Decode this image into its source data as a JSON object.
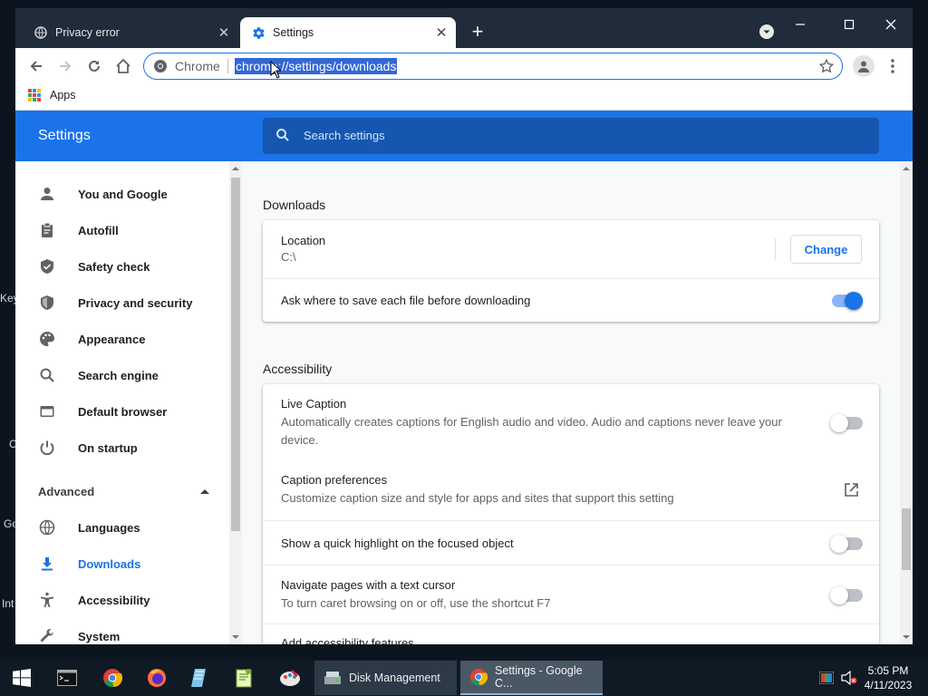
{
  "desktop": {
    "labels": [
      "Key",
      "C",
      "Go",
      "Int"
    ]
  },
  "tabs": [
    {
      "title": "Privacy error",
      "icon": "globe-icon"
    },
    {
      "title": "Settings",
      "icon": "settings-gear-icon"
    }
  ],
  "omnibox": {
    "chip": "Chrome",
    "url": "chrome://settings/downloads"
  },
  "bookmarks": {
    "apps_label": "Apps"
  },
  "settings": {
    "title": "Settings",
    "search_placeholder": "Search settings"
  },
  "sidebar": {
    "items": [
      {
        "label": "You and Google",
        "icon": "person-icon"
      },
      {
        "label": "Autofill",
        "icon": "clipboard-icon"
      },
      {
        "label": "Safety check",
        "icon": "shield-check-icon"
      },
      {
        "label": "Privacy and security",
        "icon": "shield-icon"
      },
      {
        "label": "Appearance",
        "icon": "palette-icon"
      },
      {
        "label": "Search engine",
        "icon": "search-icon"
      },
      {
        "label": "Default browser",
        "icon": "browser-icon"
      },
      {
        "label": "On startup",
        "icon": "power-icon"
      }
    ],
    "advanced_label": "Advanced",
    "advanced_items": [
      {
        "label": "Languages",
        "icon": "globe-icon"
      },
      {
        "label": "Downloads",
        "icon": "download-icon",
        "selected": true
      },
      {
        "label": "Accessibility",
        "icon": "accessibility-icon"
      },
      {
        "label": "System",
        "icon": "wrench-icon"
      }
    ]
  },
  "downloads": {
    "section_title": "Downloads",
    "location_label": "Location",
    "location_value": "C:\\",
    "change_label": "Change",
    "ask_label": "Ask where to save each file before downloading",
    "ask_enabled": true
  },
  "accessibility": {
    "section_title": "Accessibility",
    "live_caption_label": "Live Caption",
    "live_caption_sub": "Automatically creates captions for English audio and video. Audio and captions never leave your device.",
    "live_caption_enabled": false,
    "caption_prefs_label": "Caption preferences",
    "caption_prefs_sub": "Customize caption size and style for apps and sites that support this setting",
    "highlight_label": "Show a quick highlight on the focused object",
    "highlight_enabled": false,
    "caret_label": "Navigate pages with a text cursor",
    "caret_sub": "To turn caret browsing on or off, use the shortcut F7",
    "caret_enabled": false,
    "add_features_label": "Add accessibility features"
  },
  "taskbar": {
    "windows": [
      {
        "label": "Disk Management",
        "icon": "disk-management-icon"
      },
      {
        "label": "Settings - Google C...",
        "icon": "chrome-icon"
      }
    ],
    "time": "5:05 PM",
    "date": "4/11/2023"
  },
  "colors": {
    "accent": "#1a73e8",
    "titlebar": "#202c3a",
    "taskbar": "#0f1a24"
  }
}
